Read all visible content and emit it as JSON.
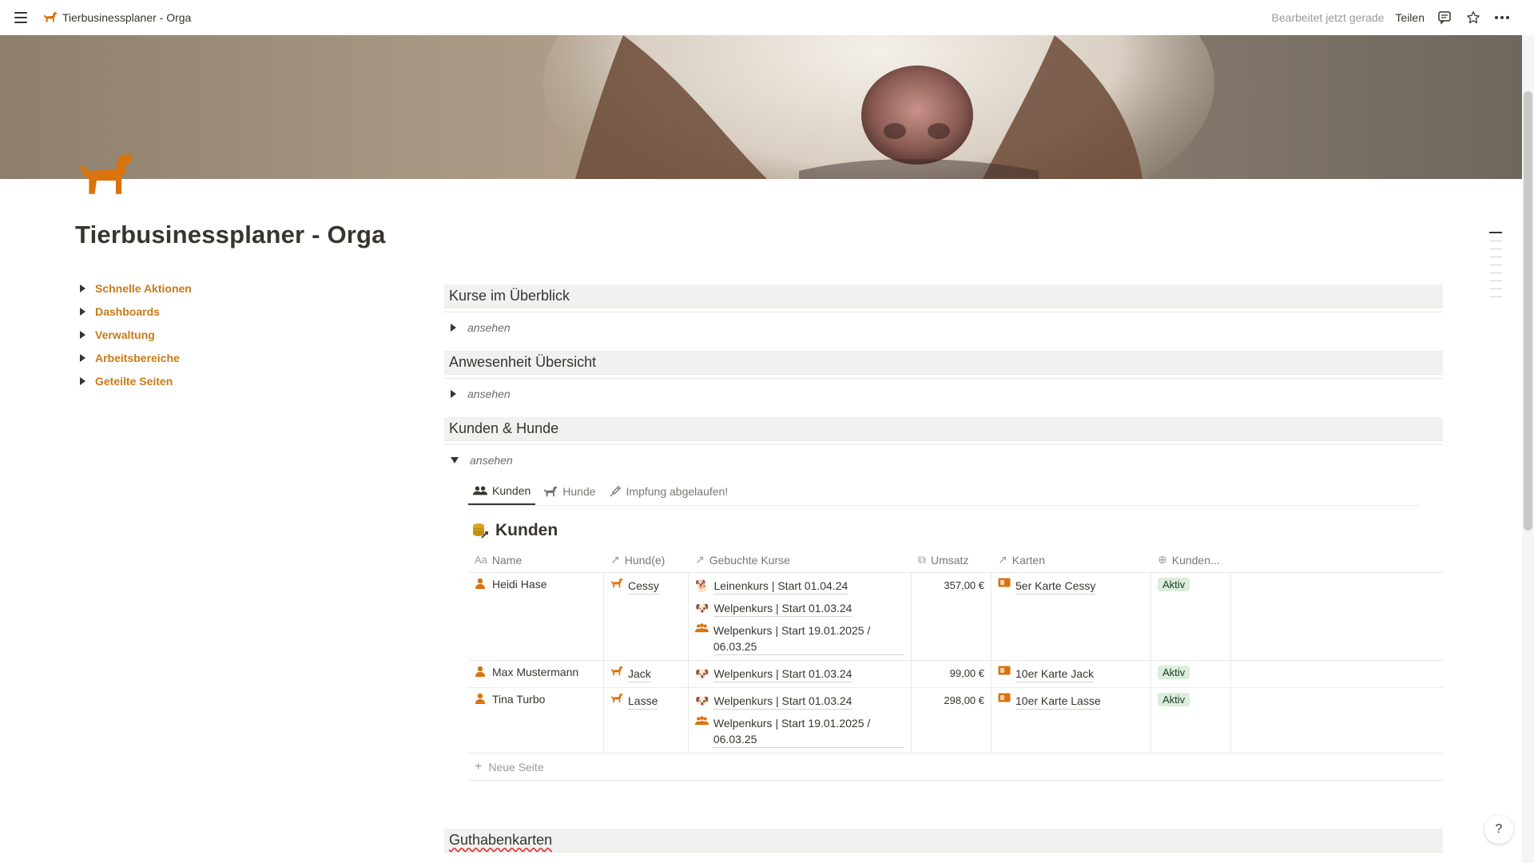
{
  "topbar": {
    "breadcrumb": "Tierbusinessplaner - Orga",
    "edited": "Bearbeitet jetzt gerade",
    "share": "Teilen"
  },
  "page": {
    "title": "Tierbusinessplaner - Orga",
    "icon": "dog-icon",
    "accent_color": "#d9730d"
  },
  "left_toggles": [
    {
      "label": "Schnelle Aktionen"
    },
    {
      "label": "Dashboards"
    },
    {
      "label": "Verwaltung"
    },
    {
      "label": "Arbeitsbereiche"
    },
    {
      "label": "Geteilte Seiten"
    }
  ],
  "sections": {
    "kurse": {
      "title": "Kurse im Überblick",
      "toggle": "ansehen"
    },
    "anwesenheit": {
      "title": "Anwesenheit Übersicht",
      "toggle": "ansehen"
    },
    "kunden": {
      "title": "Kunden & Hunde",
      "toggle": "ansehen"
    },
    "guthaben": {
      "title": "Guthabenkarten"
    }
  },
  "tabs": [
    {
      "label": "Kunden",
      "icon": "people-icon"
    },
    {
      "label": "Hunde",
      "icon": "dog-icon"
    },
    {
      "label": "Impfung abgelaufen!",
      "icon": "syringe-icon"
    }
  ],
  "database": {
    "title": "Kunden",
    "icon": "coins-icon",
    "columns": {
      "name": "Name",
      "hund": "Hund(e)",
      "kurse": "Gebuchte Kurse",
      "umsatz": "Umsatz",
      "karten": "Karten",
      "status": "Kunden..."
    },
    "rows": [
      {
        "name": "Heidi Hase",
        "hund": "Cessy",
        "kurse": [
          {
            "label": "Leinenkurs | Start 01.04.24",
            "icon": "leash-icon"
          },
          {
            "label": "Welpenkurs | Start 01.03.24",
            "icon": "puppy-icon"
          },
          {
            "label": "Welpenkurs | Start 19.01.2025 / 06.03.25",
            "icon": "group-icon"
          }
        ],
        "umsatz": "357,00 €",
        "karten": "5er Karte Cessy",
        "status": "Aktiv"
      },
      {
        "name": "Max Mustermann",
        "hund": "Jack",
        "kurse": [
          {
            "label": "Welpenkurs | Start 01.03.24",
            "icon": "puppy-icon"
          }
        ],
        "umsatz": "99,00 €",
        "karten": "10er Karte Jack",
        "status": "Aktiv"
      },
      {
        "name": "Tina Turbo",
        "hund": "Lasse",
        "kurse": [
          {
            "label": "Welpenkurs | Start 01.03.24",
            "icon": "puppy-icon"
          },
          {
            "label": "Welpenkurs | Start 19.01.2025 / 06.03.25",
            "icon": "group-icon"
          }
        ],
        "umsatz": "298,00 €",
        "karten": "10er Karte Lasse",
        "status": "Aktiv"
      }
    ],
    "new_page": "Neue Seite"
  },
  "help": {
    "label": "?"
  }
}
